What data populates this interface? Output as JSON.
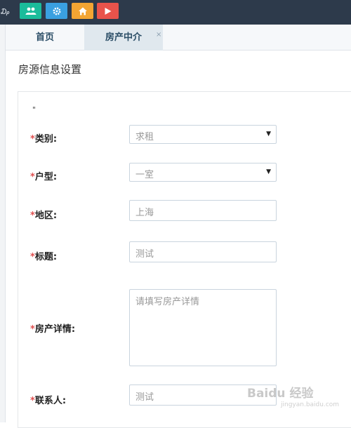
{
  "topbar": {
    "edge_glyph": "₯",
    "buttons": [
      {
        "icon": "users-icon",
        "color": "#1bbc9b"
      },
      {
        "icon": "gear-icon",
        "color": "#3aa0e0"
      },
      {
        "icon": "home-icon",
        "color": "#f3a533"
      },
      {
        "icon": "play-icon",
        "color": "#e8534b"
      }
    ]
  },
  "tabs": {
    "home": "首页",
    "agency": "房产中介",
    "close_glyph": "×"
  },
  "page": {
    "title": "房源信息设置",
    "quote_mark": "\""
  },
  "form": {
    "required_mark": "*",
    "category": {
      "label": "类别:",
      "value": "求租"
    },
    "layout": {
      "label": "户型:",
      "value": "一室"
    },
    "region": {
      "label": "地区:",
      "value": "上海"
    },
    "title": {
      "label": "标题:",
      "value": "测试"
    },
    "details": {
      "label": "房产详情:",
      "placeholder": "请填写房产详情"
    },
    "contact": {
      "label": "联系人:",
      "value": "测试"
    }
  },
  "watermark": {
    "text": "Baidu 经验",
    "sub": "jingyan.baidu.com"
  }
}
